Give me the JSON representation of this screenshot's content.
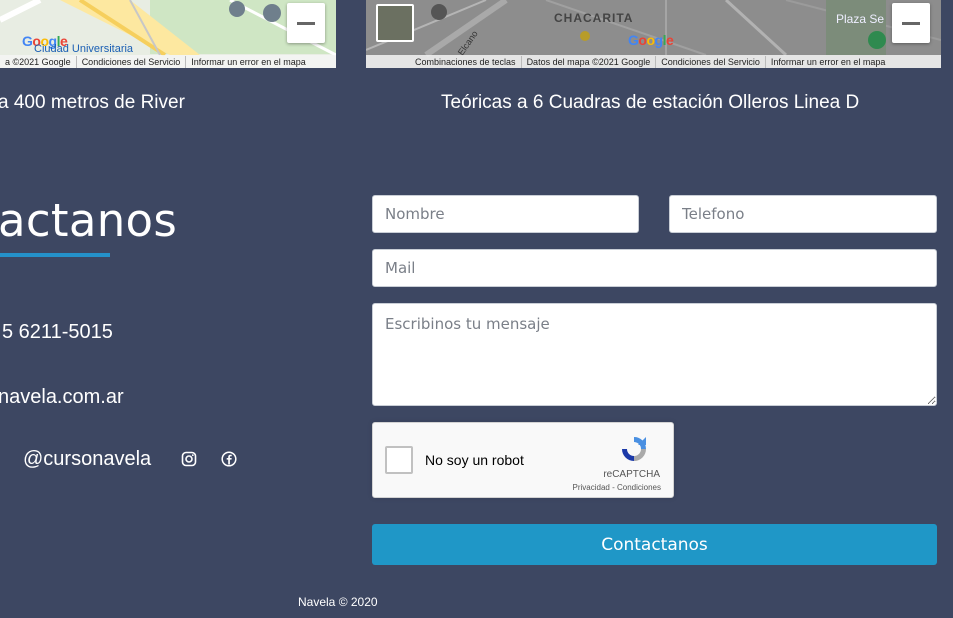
{
  "map_left": {
    "logo": "Google",
    "label_place": "Ciudad Universitaria",
    "footer": [
      "a ©2021 Google",
      "Condiciones del Servicio",
      "Informar un error en el mapa"
    ],
    "caption": "a 400 metros de River"
  },
  "map_right": {
    "logo": "Google",
    "label_place": "CHACARITA",
    "label_place2": "Plaza Se",
    "label_street": "Elcano",
    "footer": [
      "Combinaciones de teclas",
      "Datos del mapa ©2021 Google",
      "Condiciones del Servicio",
      "Informar un error en el mapa"
    ],
    "caption": "Teóricas a 6 Cuadras de estación Olleros Linea D"
  },
  "contact": {
    "heading": "actanos",
    "phone": "5 6211-5015",
    "email": "navela.com.ar",
    "social_handle": "@cursonavela"
  },
  "form": {
    "name_placeholder": "Nombre",
    "phone_placeholder": "Telefono",
    "mail_placeholder": "Mail",
    "message_placeholder": "Escribinos tu mensaje",
    "captcha_label": "No soy un robot",
    "captcha_brand": "reCAPTCHA",
    "captcha_links": "Privacidad - Condiciones",
    "submit_label": "Contactanos"
  },
  "footer": {
    "copyright": "Navela © 2020"
  },
  "colors": {
    "background": "#3d4762",
    "accent": "#2491c9",
    "button": "#1f97c7"
  }
}
